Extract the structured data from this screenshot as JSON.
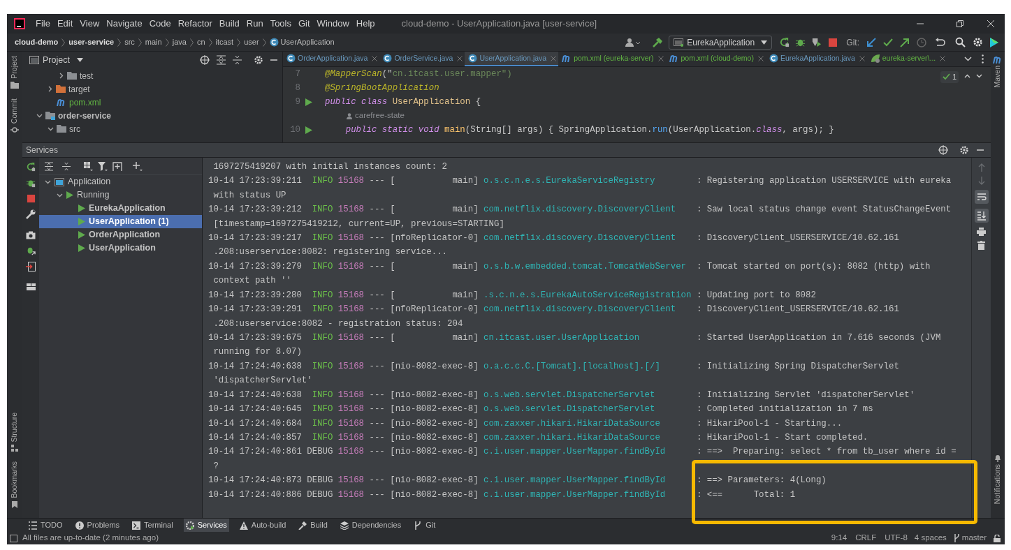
{
  "window": {
    "title": "cloud-demo - UserApplication.java [user-service]"
  },
  "menu": [
    "File",
    "Edit",
    "View",
    "Navigate",
    "Code",
    "Refactor",
    "Build",
    "Run",
    "Tools",
    "Git",
    "Window",
    "Help"
  ],
  "breadcrumbs": [
    {
      "label": "cloud-demo",
      "bold": true
    },
    {
      "label": "user-service",
      "bold": true
    },
    {
      "label": "src",
      "bold": false
    },
    {
      "label": "main",
      "bold": false
    },
    {
      "label": "java",
      "bold": false
    },
    {
      "label": "cn",
      "bold": false
    },
    {
      "label": "itcast",
      "bold": false
    },
    {
      "label": "user",
      "bold": false
    },
    {
      "label": "UserApplication",
      "bold": false,
      "kind": "class"
    }
  ],
  "toolbar": {
    "run_config": "EurekaApplication",
    "git_label": "Git:"
  },
  "left_stripe": [
    "Project",
    "Commit",
    "Structure",
    "Bookmarks"
  ],
  "right_stripe": [
    "Maven",
    "Notifications"
  ],
  "project": {
    "title": "Project",
    "items": [
      {
        "children": [
          {
            "children": [
              {
                "label": "test",
                "kind": "folder",
                "expanded": false,
                "color": "#bbbbbb"
              }
            ]
          },
          {
            "label": "target",
            "kind": "excluded-folder",
            "expanded": false,
            "color": "#bbbbbb"
          },
          {
            "label": "pom.xml",
            "kind": "maven-file",
            "color": "#62b543"
          }
        ]
      },
      {
        "label": "order-service",
        "kind": "module",
        "expanded": true,
        "color": "#bbbbbb",
        "children": [
          {
            "label": "src",
            "kind": "folder",
            "expanded": true,
            "color": "#bbbbbb"
          }
        ]
      }
    ]
  },
  "editor": {
    "tabs": [
      {
        "label": "OrderApplication.java",
        "kind": "class",
        "color": "#6897bb",
        "selected": false
      },
      {
        "label": "OrderService.java",
        "kind": "class",
        "color": "#6897bb",
        "selected": false
      },
      {
        "label": "UserApplication.java",
        "kind": "class",
        "color": "#6897bb",
        "selected": true
      },
      {
        "label": "pom.xml (eureka-server)",
        "kind": "maven",
        "color": "#62b543",
        "selected": false
      },
      {
        "label": "pom.xml (cloud-demo)",
        "kind": "maven",
        "color": "#62b543",
        "selected": false
      },
      {
        "label": "EurekaApplication.java",
        "kind": "class",
        "color": "#6897bb",
        "selected": false
      },
      {
        "label": "eureka-server\\...",
        "kind": "spring",
        "color": "#62b543",
        "selected": false
      }
    ],
    "inspection_count": "1",
    "lines": [
      {
        "kind": "code",
        "number": "7",
        "runnable": false,
        "segments": [
          {
            "kind": "annotation",
            "text": "@MapperScan"
          },
          {
            "kind": "plain",
            "text": "(\""
          },
          {
            "kind": "string",
            "text": "cn.itcast.user.mapper"
          },
          {
            "kind": "string",
            "text": "\")"
          }
        ]
      },
      {
        "kind": "code",
        "number": "8",
        "runnable": false,
        "segments": [
          {
            "kind": "annotation",
            "text": "@SpringBootApplication"
          }
        ]
      },
      {
        "kind": "code",
        "number": "9",
        "runnable": true,
        "segments": [
          {
            "kind": "keyword",
            "text": "public class "
          },
          {
            "kind": "type",
            "text": "UserApplication"
          },
          {
            "kind": "plain",
            "text": " {"
          }
        ]
      },
      {
        "kind": "inlay",
        "text": "carefree-state"
      },
      {
        "kind": "code",
        "number": "10",
        "runnable": true,
        "segments": [
          {
            "kind": "keyword",
            "text": "    public static void "
          },
          {
            "kind": "method",
            "text": "main"
          },
          {
            "kind": "plain",
            "text": "(String[] args) { SpringApplication."
          },
          {
            "kind": "call",
            "text": "run"
          },
          {
            "kind": "plain",
            "text": "(UserApplication."
          },
          {
            "kind": "keyword",
            "text": "class"
          },
          {
            "kind": "plain",
            "text": ", args); }"
          }
        ]
      }
    ]
  },
  "services": {
    "title": "Services",
    "tree": [
      {
        "label": "Application",
        "kind": "group",
        "expanded": true,
        "selected": false,
        "children": [
          {
            "label": "Running",
            "kind": "status",
            "expanded": true,
            "selected": false,
            "children": [
              {
                "label": "EurekaApplication",
                "kind": "app",
                "selected": false
              },
              {
                "label": "UserApplication (1)",
                "kind": "app",
                "selected": true
              },
              {
                "label": "OrderApplication",
                "kind": "app",
                "selected": false
              },
              {
                "label": "UserApplication",
                "kind": "app",
                "selected": false
              }
            ]
          }
        ]
      }
    ],
    "log": [
      {
        "kind": "continuation",
        "text": "1697275419207 with initial instances count: 2"
      },
      {
        "kind": "entry",
        "time": "10-14 17:23:39:211",
        "level": "INFO",
        "pid": "15168",
        "sep": "---",
        "thread": "[           main]",
        "logger": "o.s.c.n.e.s.EurekaServiceRegistry",
        "message": ": Registering application USERSERVICE with eureka"
      },
      {
        "kind": "continuation",
        "text": "with status UP"
      },
      {
        "kind": "entry",
        "time": "10-14 17:23:39:212",
        "level": "INFO",
        "pid": "15168",
        "sep": "---",
        "thread": "[           main]",
        "logger": "com.netflix.discovery.DiscoveryClient",
        "message": ": Saw local status change event StatusChangeEvent"
      },
      {
        "kind": "continuation",
        "text": "[timestamp=1697275419212, current=UP, previous=STARTING]"
      },
      {
        "kind": "entry",
        "time": "10-14 17:23:39:217",
        "level": "INFO",
        "pid": "15168",
        "sep": "---",
        "thread": "[nfoReplicator-0]",
        "logger": "com.netflix.discovery.DiscoveryClient",
        "message": ": DiscoveryClient_USERSERVICE/10.62.161"
      },
      {
        "kind": "continuation",
        "text": ".208:userservice:8082: registering service..."
      },
      {
        "kind": "entry",
        "time": "10-14 17:23:39:279",
        "level": "INFO",
        "pid": "15168",
        "sep": "---",
        "thread": "[           main]",
        "logger": "o.s.b.w.embedded.tomcat.TomcatWebServer",
        "message": ": Tomcat started on port(s): 8082 (http) with"
      },
      {
        "kind": "continuation",
        "text": "context path ''"
      },
      {
        "kind": "entry",
        "time": "10-14 17:23:39:280",
        "level": "INFO",
        "pid": "15168",
        "sep": "---",
        "thread": "[           main]",
        "logger": ".s.c.n.e.s.EurekaAutoServiceRegistration",
        "message": ": Updating port to 8082"
      },
      {
        "kind": "entry",
        "time": "10-14 17:23:39:291",
        "level": "INFO",
        "pid": "15168",
        "sep": "---",
        "thread": "[nfoReplicator-0]",
        "logger": "com.netflix.discovery.DiscoveryClient",
        "message": ": DiscoveryClient_USERSERVICE/10.62.161"
      },
      {
        "kind": "continuation",
        "text": ".208:userservice:8082 - registration status: 204"
      },
      {
        "kind": "entry",
        "time": "10-14 17:23:39:675",
        "level": "INFO",
        "pid": "15168",
        "sep": "---",
        "thread": "[           main]",
        "logger": "cn.itcast.user.UserApplication",
        "message": ": Started UserApplication in 7.616 seconds (JVM"
      },
      {
        "kind": "continuation",
        "text": "running for 8.07)"
      },
      {
        "kind": "entry",
        "time": "10-14 17:24:40:638",
        "level": "INFO",
        "pid": "15168",
        "sep": "---",
        "thread": "[nio-8082-exec-8]",
        "logger": "o.a.c.c.C.[Tomcat].[localhost].[/]",
        "message": ": Initializing Spring DispatcherServlet"
      },
      {
        "kind": "continuation",
        "text": "'dispatcherServlet'"
      },
      {
        "kind": "entry",
        "time": "10-14 17:24:40:638",
        "level": "INFO",
        "pid": "15168",
        "sep": "---",
        "thread": "[nio-8082-exec-8]",
        "logger": "o.s.web.servlet.DispatcherServlet",
        "message": ": Initializing Servlet 'dispatcherServlet'"
      },
      {
        "kind": "entry",
        "time": "10-14 17:24:40:645",
        "level": "INFO",
        "pid": "15168",
        "sep": "---",
        "thread": "[nio-8082-exec-8]",
        "logger": "o.s.web.servlet.DispatcherServlet",
        "message": ": Completed initialization in 7 ms"
      },
      {
        "kind": "entry",
        "time": "10-14 17:24:40:684",
        "level": "INFO",
        "pid": "15168",
        "sep": "---",
        "thread": "[nio-8082-exec-8]",
        "logger": "com.zaxxer.hikari.HikariDataSource",
        "message": ": HikariPool-1 - Starting..."
      },
      {
        "kind": "entry",
        "time": "10-14 17:24:40:857",
        "level": "INFO",
        "pid": "15168",
        "sep": "---",
        "thread": "[nio-8082-exec-8]",
        "logger": "com.zaxxer.hikari.HikariDataSource",
        "message": ": HikariPool-1 - Start completed."
      },
      {
        "kind": "entry",
        "time": "10-14 17:24:40:861",
        "level": "DEBUG",
        "pid": "15168",
        "sep": "---",
        "thread": "[nio-8082-exec-8]",
        "logger": "c.i.user.mapper.UserMapper.findById",
        "message": ": ==>  Preparing: select * from tb_user where id ="
      },
      {
        "kind": "continuation",
        "text": "?"
      },
      {
        "kind": "entry",
        "time": "10-14 17:24:40:873",
        "level": "DEBUG",
        "pid": "15168",
        "sep": "---",
        "thread": "[nio-8082-exec-8]",
        "logger": "c.i.user.mapper.UserMapper.findById",
        "message": ": ==> Parameters: 4(Long)"
      },
      {
        "kind": "entry",
        "time": "10-14 17:24:40:886",
        "level": "DEBUG",
        "pid": "15168",
        "sep": "---",
        "thread": "[nio-8082-exec-8]",
        "logger": "c.i.user.mapper.UserMapper.findById",
        "message": ": <==      Total: 1"
      }
    ]
  },
  "bottom_tabs": [
    {
      "label": "TODO",
      "kind": "todo",
      "selected": false
    },
    {
      "label": "Problems",
      "kind": "problems",
      "selected": false
    },
    {
      "label": "Terminal",
      "kind": "terminal",
      "selected": false
    },
    {
      "label": "Services",
      "kind": "services",
      "selected": true
    },
    {
      "label": "Auto-build",
      "kind": "warning",
      "selected": false
    },
    {
      "label": "Build",
      "kind": "build",
      "selected": false
    },
    {
      "label": "Dependencies",
      "kind": "dependencies",
      "selected": false
    },
    {
      "label": "Git",
      "kind": "git",
      "selected": false
    }
  ],
  "status_bar": {
    "message": "All files are up-to-date (2 minutes ago)",
    "position": "9:14",
    "line_ending": "CRLF",
    "encoding": "UTF-8",
    "indent": "4 spaces",
    "branch": "master"
  }
}
